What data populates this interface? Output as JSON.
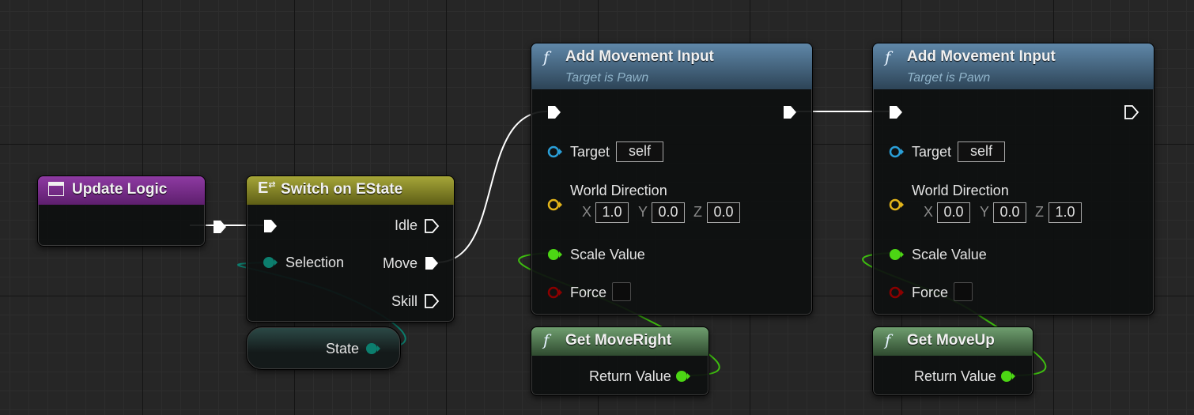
{
  "colors": {
    "exec_wire": "#ffffff",
    "float_pin": "#4cd614",
    "object_pin": "#2a9fd8",
    "vector_pin": "#e2b41a",
    "bool_pin": "#8b0000",
    "byte_pin": "#0c7e6e",
    "event_header": "#7a2a8c",
    "switch_header": "#8a8a26",
    "function_header": "#4f6e8c",
    "pure_header": "#4f7a4f"
  },
  "nodes": {
    "update_logic": {
      "title": "Update Logic",
      "icon": "event-icon"
    },
    "switch": {
      "title": "Switch on EState",
      "icon": "enum-switch-icon",
      "selection_label": "Selection",
      "outputs": [
        "Idle",
        "Move",
        "Skill"
      ]
    },
    "state_var": {
      "label": "State"
    },
    "add_move_1": {
      "fx": "f",
      "title": "Add Movement Input",
      "subtitle": "Target is Pawn",
      "target_label": "Target",
      "target_value": "self",
      "world_direction_label": "World Direction",
      "x_label": "X",
      "x_value": "1.0",
      "y_label": "Y",
      "y_value": "0.0",
      "z_label": "Z",
      "z_value": "0.0",
      "scale_label": "Scale Value",
      "force_label": "Force"
    },
    "add_move_2": {
      "fx": "f",
      "title": "Add Movement Input",
      "subtitle": "Target is Pawn",
      "target_label": "Target",
      "target_value": "self",
      "world_direction_label": "World Direction",
      "x_label": "X",
      "x_value": "0.0",
      "y_label": "Y",
      "y_value": "0.0",
      "z_label": "Z",
      "z_value": "1.0",
      "scale_label": "Scale Value",
      "force_label": "Force"
    },
    "get_move_right": {
      "fx": "f",
      "title": "Get MoveRight",
      "return_label": "Return Value"
    },
    "get_move_up": {
      "fx": "f",
      "title": "Get MoveUp",
      "return_label": "Return Value"
    }
  }
}
